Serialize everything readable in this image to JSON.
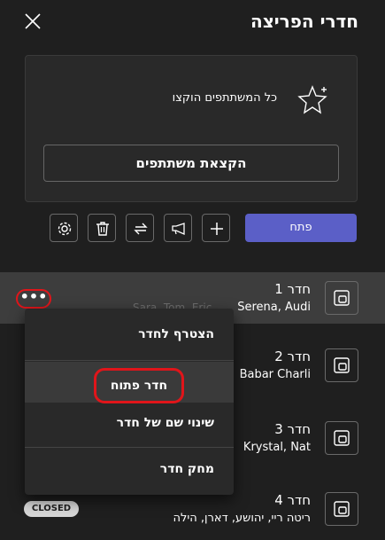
{
  "header": {
    "title": "חדרי הפריצה"
  },
  "assign": {
    "status_text": "כל המשתתפים הוקצו",
    "assign_button": "הקצאת משתתפים"
  },
  "toolbar": {
    "open_button": "פתח"
  },
  "rooms": [
    {
      "name": "חדר 1",
      "members": "Serena, Audi",
      "ghost": "Sara, Tom, Eric"
    },
    {
      "name": "חדר 2",
      "members": "Babar Charli"
    },
    {
      "name": "חדר 3",
      "members": "Krystal, Nat"
    },
    {
      "name": "חדר 4",
      "members": "ריטה ריי, יהושע, דארן, הילה",
      "status": "CLOSED"
    }
  ],
  "more_button": "•••",
  "menu": {
    "join": "הצטרף לחדר",
    "open": "חדר פתוח",
    "rename": "שינוי שם של חדר",
    "delete": "מחק חדר"
  },
  "colors": {
    "accent": "#5b5fc7",
    "highlight": "#e0151a",
    "background": "#1f1f1f"
  }
}
